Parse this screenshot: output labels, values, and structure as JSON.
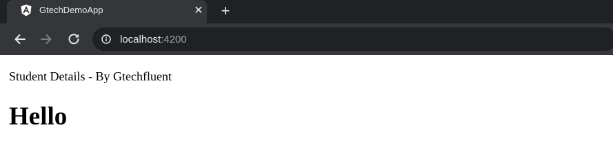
{
  "browser": {
    "tab": {
      "title": "GtechDemoApp",
      "favicon_icon": "angular-logo-icon",
      "close_icon": "close-icon",
      "close_glyph": "✕"
    },
    "new_tab": {
      "icon": "plus-icon",
      "glyph": "+"
    },
    "toolbar": {
      "back_icon": "arrow-left-icon",
      "forward_icon": "arrow-right-icon",
      "reload_icon": "reload-icon"
    },
    "address_bar": {
      "info_icon": "info-circle-icon",
      "host": "localhost",
      "port": ":4200"
    },
    "colors": {
      "tab_strip": "#202124",
      "active_tab": "#35363a",
      "omnibox": "#202124",
      "text_primary": "#e8eaed",
      "text_secondary": "#9aa0a6"
    }
  },
  "page": {
    "subtitle": "Student Details - By Gtechfluent",
    "heading": "Hello"
  }
}
